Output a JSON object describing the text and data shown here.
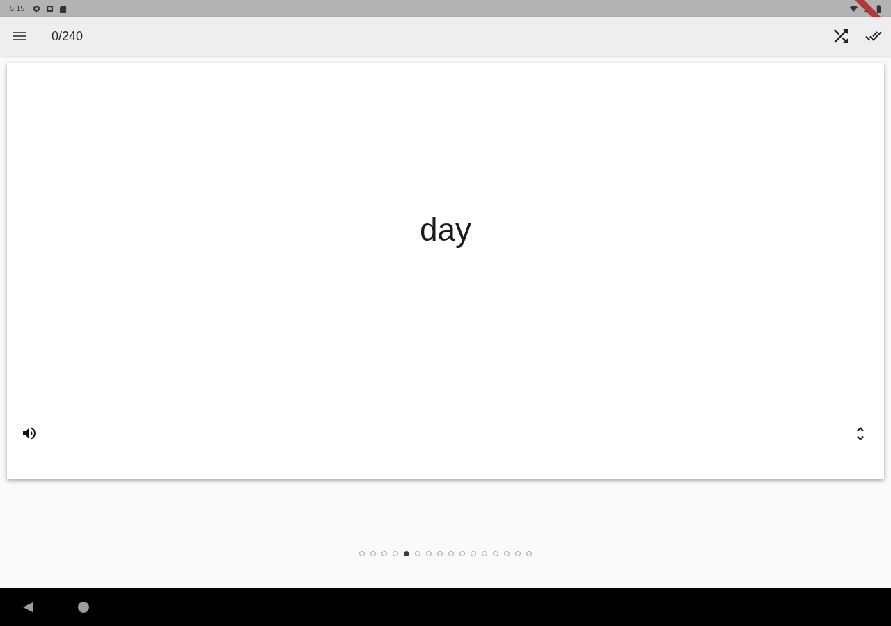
{
  "status_bar": {
    "time": "5:15"
  },
  "app_bar": {
    "counter": "0/240"
  },
  "card": {
    "word": "day"
  },
  "page_indicator": {
    "dots": [
      {
        "selected": false
      },
      {
        "selected": false
      },
      {
        "selected": false
      },
      {
        "selected": false
      },
      {
        "selected": true
      },
      {
        "selected": false
      },
      {
        "selected": false
      },
      {
        "selected": false
      },
      {
        "selected": false
      },
      {
        "selected": false
      },
      {
        "selected": false
      },
      {
        "selected": false
      },
      {
        "selected": false
      },
      {
        "selected": false
      },
      {
        "selected": false
      },
      {
        "selected": false
      }
    ]
  }
}
